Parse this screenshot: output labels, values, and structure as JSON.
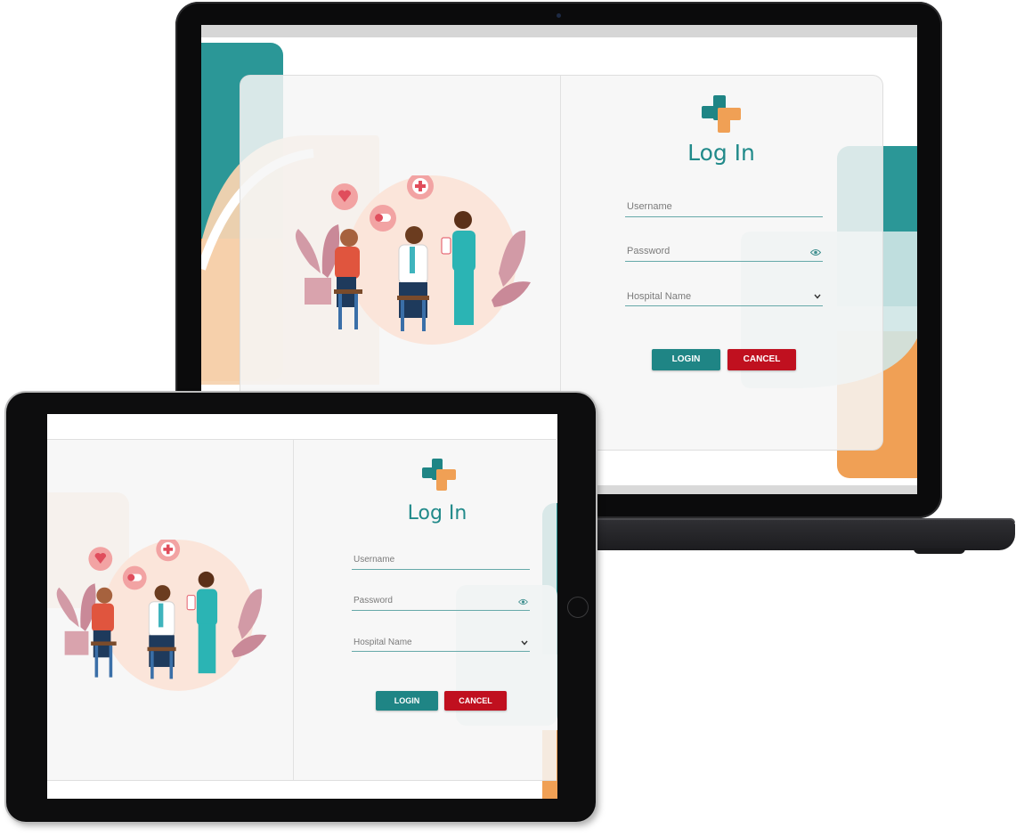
{
  "login": {
    "title": "Log In",
    "username_placeholder": "Username",
    "password_placeholder": "Password",
    "hospital_placeholder": "Hospital Name",
    "login_label": "LOGIN",
    "cancel_label": "CANCEL"
  },
  "icons": {
    "logo": "medical-cross-logo",
    "password_toggle": "eye-icon",
    "hospital_dropdown": "chevron-down-icon",
    "illustration": "doctor-patient-nurse-illustration"
  },
  "colors": {
    "brand_teal": "#2b9797",
    "brand_orange": "#f0a055",
    "title_teal": "#218a8a",
    "login_button": "#1f8585",
    "cancel_button": "#c0101f"
  }
}
